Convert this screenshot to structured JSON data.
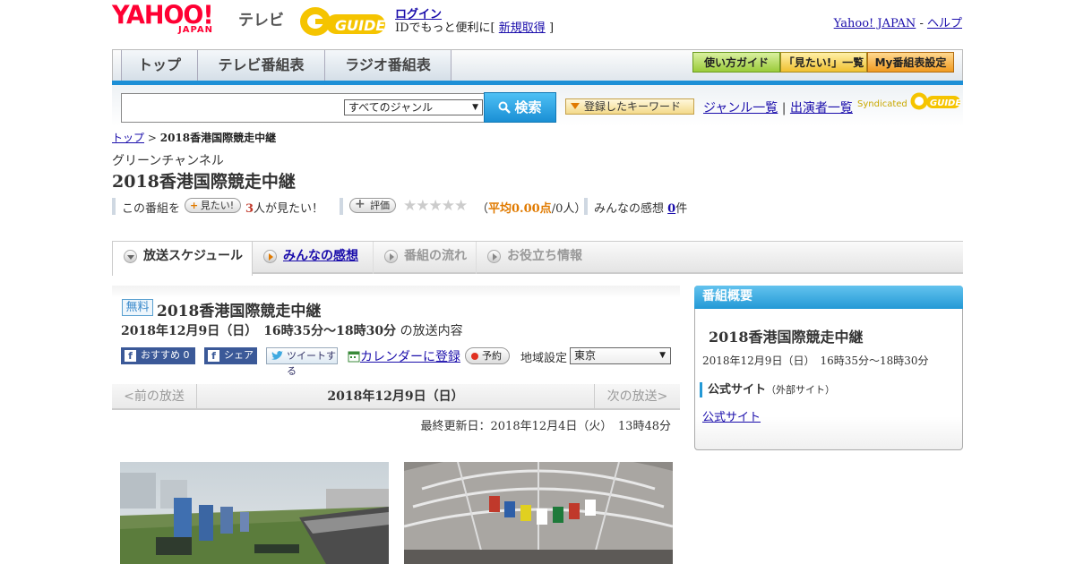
{
  "header": {
    "yahoo_logo": "YAHOO!",
    "yahoo_sub": "JAPAN",
    "tv_label": "テレビ",
    "gguide_logo": "GUIDE",
    "login": "ログイン",
    "login_sub_prefix": "IDでもっと便利に[",
    "signup": "新規取得",
    "login_sub_suffix": "]",
    "yahoo_japan": "Yahoo! JAPAN",
    "dash": "-",
    "help": "ヘルプ"
  },
  "nav": {
    "tabs": [
      "トップ",
      "テレビ番組表",
      "ラジオ番組表"
    ],
    "guide_btn": "使い方ガイド",
    "watchlist_btn": "「見たい!」一覧",
    "mylist_btn": "My番組表設定"
  },
  "search": {
    "genre": "すべてのジャンル",
    "button": "検索",
    "keyword_btn": "登録したキーワード",
    "genre_list": "ジャンル一覧",
    "sep": "|",
    "performer_list": "出演者一覧",
    "syndicated": "Syndicated"
  },
  "breadcrumb": {
    "top": "トップ",
    "sep": ">",
    "current": "2018香港国際競走中継"
  },
  "program": {
    "channel": "グリーンチャンネル",
    "title": "2018香港国際競走中継"
  },
  "rating": {
    "prefix": "この番組を",
    "want_btn": "見たい!",
    "want_count": "3",
    "want_suffix": "人が見たい！",
    "rate_btn": "評価",
    "stars": "★★★★★",
    "avg_open": "（",
    "avg_label": "平均0.00点",
    "avg_rest": "/0人）",
    "comments_label": "みんなの感想",
    "comments_count": "0",
    "comments_unit": "件"
  },
  "tabs": [
    {
      "label": "放送スケジュール"
    },
    {
      "label": "みんなの感想"
    },
    {
      "label": "番組の流れ"
    },
    {
      "label": "お役立ち情報"
    }
  ],
  "episode": {
    "badge": "無料",
    "title": "2018香港国際競走中継",
    "datetime": "2018年12月9日（日）　16時35分～18時30分",
    "datetime_suffix": "の放送内容",
    "fb_btn": "おすすめ 0",
    "share_btn": "シェア",
    "tweet_btn": "ツイートする",
    "calendar": "カレンダーに登録",
    "reserve": "予約",
    "region_label": "地域設定",
    "region_value": "東京"
  },
  "datenav": {
    "prev": "<前の放送",
    "current": "2018年12月9日（日）",
    "next": "次の放送>"
  },
  "updated": "最終更新日：2018年12月4日（火）　13時48分",
  "sidebar": {
    "header": "番組概要",
    "title": "2018香港国際競走中継",
    "time": "2018年12月9日（日）　16時35分～18時30分",
    "section": "公式サイト",
    "section_note": "（外部サイト）",
    "link": "公式サイト"
  },
  "colors": {
    "accent_blue": "#1d8fd6",
    "gold": "#f5c400",
    "link": "#1a0dab",
    "brand_red": "#ff0033"
  }
}
